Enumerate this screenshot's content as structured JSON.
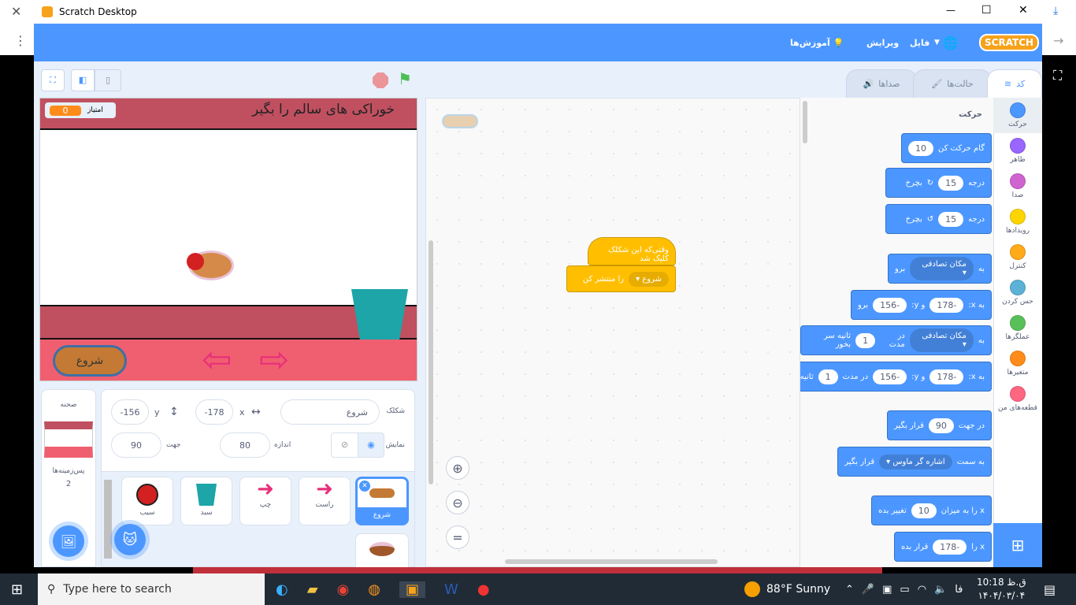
{
  "window": {
    "title": "Scratch Desktop",
    "minimize": "—",
    "maximize": "☐",
    "close": "✕"
  },
  "menu": {
    "logo": "SCRATCH",
    "file": "فایل",
    "edit": "ویرایش",
    "tutorials": "آموزش‌ها"
  },
  "tabs": {
    "code": "کد",
    "costumes": "حالت‌ها",
    "sounds": "صداها"
  },
  "stage": {
    "title": "خوراکی های سالم را بگیر",
    "score_label": "امتیاز",
    "score_value": "0",
    "start_button": "شروع"
  },
  "sprite_info": {
    "sprite_label": "شکلک",
    "sprite_name": "شروع",
    "x_label": "x",
    "x_value": "-178",
    "y_label": "y",
    "y_value": "-156",
    "show_label": "نمایش",
    "size_label": "اندازه",
    "size_value": "80",
    "direction_label": "جهت",
    "direction_value": "90"
  },
  "sprites": [
    {
      "name": "شروع"
    },
    {
      "name": "راست"
    },
    {
      "name": "چپ"
    },
    {
      "name": "سبد"
    },
    {
      "name": "سیب"
    }
  ],
  "stage_pane": {
    "title": "صحنه",
    "backdrops_label": "پس‌زمینه‌ها",
    "backdrops_count": "2"
  },
  "categories": [
    {
      "name": "حرکت",
      "color": "#4c97ff"
    },
    {
      "name": "ظاهر",
      "color": "#9966ff"
    },
    {
      "name": "صدا",
      "color": "#cf63cf"
    },
    {
      "name": "رویدادها",
      "color": "#ffd500"
    },
    {
      "name": "کنترل",
      "color": "#ffab19"
    },
    {
      "name": "حس کردن",
      "color": "#5cb1d6"
    },
    {
      "name": "عملگرها",
      "color": "#59c059"
    },
    {
      "name": "متغیرها",
      "color": "#ff8c1a"
    },
    {
      "name": "قطعه‌های من",
      "color": "#ff6680"
    }
  ],
  "palette": {
    "heading": "حرکت",
    "b1": {
      "a": "10",
      "t": "گام حرکت کن"
    },
    "b2": {
      "a": "15",
      "t": "درجه",
      "t2": "بچرخ"
    },
    "b3": {
      "a": "15",
      "t": "درجه",
      "t2": "بچرخ"
    },
    "b4": {
      "t": "به",
      "d": "مکان تصادفی",
      "t2": "برو"
    },
    "b5": {
      "t": "به x:",
      "x": "-178",
      "t2": "و y:",
      "y": "-156",
      "t3": "برو"
    },
    "b6": {
      "t": "به",
      "d": "مکان تصادفی",
      "t2": "در مدت",
      "n": "1",
      "t3": "ثانیه سر بخور"
    },
    "b7": {
      "t": "به x:",
      "x": "-178",
      "t2": "و y:",
      "y": "-156",
      "t3": "در مدت",
      "n": "1",
      "t4": "ثانیه سر بخ"
    },
    "b8": {
      "t": "در جهت",
      "a": "90",
      "t2": "قرار بگیر"
    },
    "b9": {
      "t": "به سمت",
      "d": "اشاره گر ماوس",
      "t2": "قرار بگیر"
    },
    "b10": {
      "t": "x را به میزان",
      "a": "10",
      "t2": "تغییر بده"
    },
    "b11": {
      "t": "x را",
      "a": "-178",
      "t2": "قرار بده"
    }
  },
  "script": {
    "hat": "وقتی‌که این شکلک کلیک شد",
    "broadcast_menu": "شروع",
    "broadcast_text": "را منتشر کن"
  },
  "taskbar": {
    "search": "Type here to search",
    "weather": "88°F  Sunny",
    "lang": "فا",
    "time": "10:18 ق.ظ",
    "date": "۱۴۰۴/۰۳/۰۴"
  }
}
